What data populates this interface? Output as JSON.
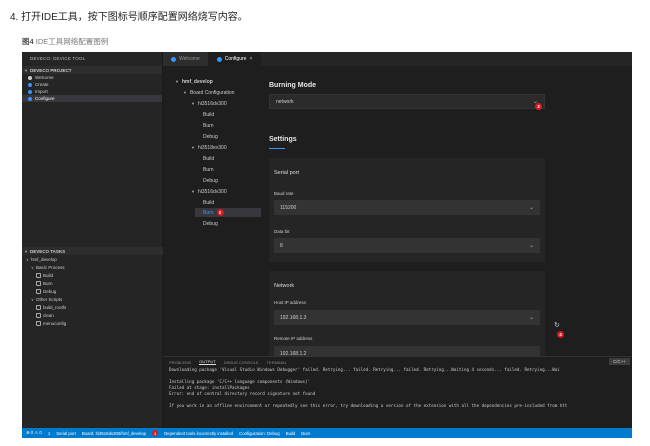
{
  "doc": {
    "step": "4. 打开IDE工具，按下图标号顺序配置网络烧写内容。",
    "caption_bold": "图4",
    "caption_text": " IDE工具网络配置图例"
  },
  "sidebar": {
    "title": "DEVECO: DEVICE TOOL",
    "project_section": "DEVECO PROJECT",
    "project_items": [
      "Welcome",
      "Create",
      "Import",
      "Configure"
    ],
    "tasks_section": "DEVECO TASKS",
    "tasks": {
      "root": "hmf_develop",
      "basic": "Basic Process",
      "basic_items": [
        "Build",
        "Burn",
        "Debug"
      ],
      "other": "Other Scripts",
      "other_items": [
        "build_rootfs",
        "clean",
        "menuconfig"
      ]
    }
  },
  "tabs": [
    {
      "label": "Welcome",
      "active": false
    },
    {
      "label": "Configure",
      "active": true,
      "close": "×"
    }
  ],
  "tree": {
    "root": "hmf_develop",
    "board_config": "Board Configuration",
    "boards": [
      {
        "name": "hi3516dv300",
        "items": [
          "Build",
          "Burn",
          "Debug"
        ]
      },
      {
        "name": "hi3518ev300",
        "items": [
          "Build",
          "Burn",
          "Debug"
        ]
      },
      {
        "name": "hi3516dv300",
        "items": [
          "Build",
          "Burn",
          "Debug"
        ]
      }
    ],
    "selected_badge": "2"
  },
  "panel": {
    "burning_mode_label": "Burning Mode",
    "burning_mode_value": "network",
    "burning_badge": "3",
    "settings_label": "Settings",
    "serial_port_label": "Serial port",
    "baud_rate_label": "Baud rate",
    "baud_rate_value": "115200",
    "data_bit_label": "Data bit",
    "data_bit_value": "8",
    "network_label": "Network",
    "host_ip_label": "Host IP address",
    "host_ip_value": "192.168.1.3",
    "host_ip_badge": "4",
    "remote_ip_label": "Remote IP address",
    "remote_ip_value": "192.168.1.2"
  },
  "terminal": {
    "tabs": [
      "PROBLEMS",
      "OUTPUT",
      "DEBUG CONSOLE",
      "TERMINAL"
    ],
    "active_tab": "OUTPUT",
    "lang": "C/C++",
    "lines": [
      "Downloading package 'Visual Studio Windows Debugger' failed. Retrying... failed. Retrying... failed. Retrying...Waiting 4 seconds... failed. Retrying...Wai",
      "",
      "Installing package 'C/C++ language components (Windows)'",
      "Failed at stage: installPackages",
      "Error: end of central directory record signature not found",
      "",
      "If you work in an offline environment or repeatedly see this error, try downloading a version of the extension with all the dependencies pre-included from htt"
    ]
  },
  "statusbar": {
    "problems": "⊗ 0 ⚠ 0",
    "count": "1",
    "serial_port": "Serial port",
    "board": "Board: hi3516dv300/hmf_develop",
    "board_badge": "1",
    "devtools": "Dependent tools incorrectly installed",
    "configuration": "Configuration: Debug",
    "build": "Build",
    "burn": "Burn"
  },
  "colors": {
    "accent": "#007acc",
    "badge": "#d71920",
    "background": "#1e1e1e"
  }
}
